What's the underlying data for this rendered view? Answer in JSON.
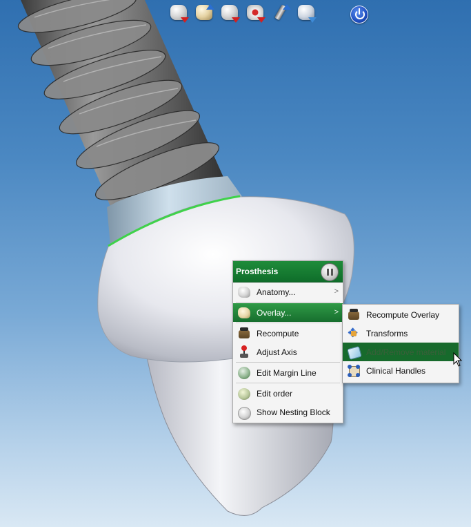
{
  "toolbar": {
    "tools": [
      {
        "name": "tooth-remove-tool-icon"
      },
      {
        "name": "tooth-import-tool-icon"
      },
      {
        "name": "tooth-export-tool-icon"
      },
      {
        "name": "scan-tool-icon"
      },
      {
        "name": "pen-tool-icon"
      },
      {
        "name": "shape-tool-icon"
      },
      {
        "name": "power-icon"
      }
    ]
  },
  "context_menu": {
    "title": "Prosthesis",
    "items": [
      {
        "label": "Anatomy...",
        "icon": "anatomy-icon",
        "submenu": true
      },
      {
        "label": "Overlay...",
        "icon": "overlay-icon",
        "submenu": true,
        "highlighted": true
      },
      {
        "label": "Recompute",
        "icon": "recompute-icon"
      },
      {
        "label": "Adjust Axis",
        "icon": "adjust-axis-icon"
      },
      {
        "label": "Edit Margin Line",
        "icon": "margin-line-icon"
      },
      {
        "label": "Edit order",
        "icon": "edit-order-icon"
      },
      {
        "label": "Show Nesting Block",
        "icon": "nesting-block-icon"
      }
    ]
  },
  "overlay_submenu": {
    "items": [
      {
        "label": "Recompute Overlay",
        "icon": "recompute-overlay-icon"
      },
      {
        "label": "Transforms",
        "icon": "transforms-icon"
      },
      {
        "label": "Add/Remove material",
        "icon": "add-remove-material-icon",
        "highlighted": true
      },
      {
        "label": "Clinical Handles",
        "icon": "clinical-handles-icon"
      }
    ]
  },
  "colors": {
    "accent_green": "#176e2e",
    "margin_line": "#3fd24a",
    "background_top": "#2f6fb0",
    "background_bottom": "#d9e8f4"
  }
}
